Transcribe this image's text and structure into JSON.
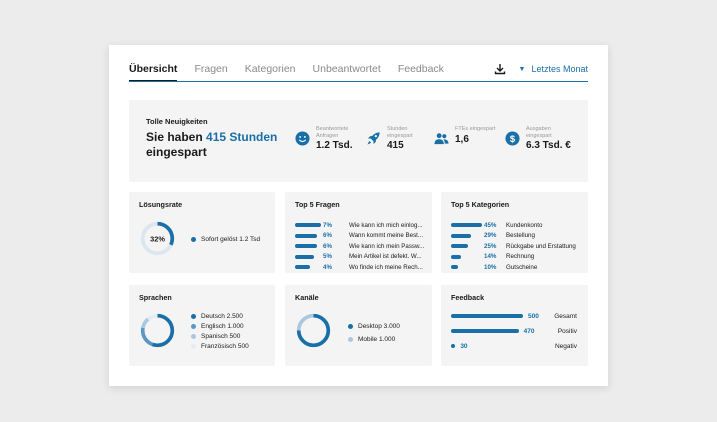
{
  "tabs": [
    "Übersicht",
    "Fragen",
    "Kategorien",
    "Unbeantwortet",
    "Feedback"
  ],
  "period": "Letztes Monat",
  "hero": {
    "kicker": "Tolle Neuigkeiten",
    "title_pre": "Sie haben ",
    "title_highlight": "415 Stunden",
    "title_post": "eingespart",
    "stats": [
      {
        "icon": "smiley-icon",
        "label": "Beantwortete Anfragen",
        "value": "1.2 Tsd."
      },
      {
        "icon": "rocket-icon",
        "label": "Stunden eingespart",
        "value": "415"
      },
      {
        "icon": "people-icon",
        "label": "FTEs eingespart",
        "value": "1,6"
      },
      {
        "icon": "dollar-icon",
        "label": "Ausgaben eingespart",
        "value": "6.3 Tsd. €"
      }
    ]
  },
  "loesungsrate": {
    "title": "Lösungsrate",
    "center": "32%",
    "percent": 32,
    "legend": "Sofort gelöst 1.2 Tsd"
  },
  "top_fragen": {
    "title": "Top 5 Fragen",
    "items": [
      {
        "pct": "7%",
        "value": 7,
        "text": "Wie kann ich mich einlog..."
      },
      {
        "pct": "6%",
        "value": 6,
        "text": "Wann kommt meine Best..."
      },
      {
        "pct": "6%",
        "value": 6,
        "text": "Wie kann ich mein Passw..."
      },
      {
        "pct": "5%",
        "value": 5,
        "text": "Mein Artikel ist defekt. W..."
      },
      {
        "pct": "4%",
        "value": 4,
        "text": "Wo finde ich meine Rech..."
      }
    ]
  },
  "top_kategorien": {
    "title": "Top 5 Kategorien",
    "items": [
      {
        "pct": "45%",
        "value": 45,
        "text": "Kundenkonto"
      },
      {
        "pct": "29%",
        "value": 29,
        "text": "Bestellung"
      },
      {
        "pct": "25%",
        "value": 25,
        "text": "Rückgabe und Erstattung"
      },
      {
        "pct": "14%",
        "value": 14,
        "text": "Rechnung"
      },
      {
        "pct": "10%",
        "value": 10,
        "text": "Gutscheine"
      }
    ]
  },
  "sprachen": {
    "title": "Sprachen",
    "items": [
      {
        "label": "Deutsch 2.500",
        "value": 2500,
        "color": "#1a6fa8"
      },
      {
        "label": "Englisch 1.000",
        "value": 1000,
        "color": "#5b97c4"
      },
      {
        "label": "Spanisch 500",
        "value": 500,
        "color": "#a9c8df"
      },
      {
        "label": "Französisch 500",
        "value": 500,
        "color": "#e4edf4"
      }
    ]
  },
  "kanaele": {
    "title": "Kanäle",
    "items": [
      {
        "label": "Desktop 3.000",
        "value": 3000,
        "color": "#1a6fa8"
      },
      {
        "label": "Mobile 1.000",
        "value": 1000,
        "color": "#a9c8df"
      }
    ]
  },
  "feedback": {
    "title": "Feedback",
    "items": [
      {
        "value": 500,
        "display": "500",
        "label": "Gesamt"
      },
      {
        "value": 470,
        "display": "470",
        "label": "Positiv"
      },
      {
        "value": 30,
        "display": "30",
        "label": "Negativ"
      }
    ]
  },
  "colors": {
    "accent": "#1a6fa8",
    "panel": "#f4f4f4",
    "light": "#dbe6ef"
  }
}
